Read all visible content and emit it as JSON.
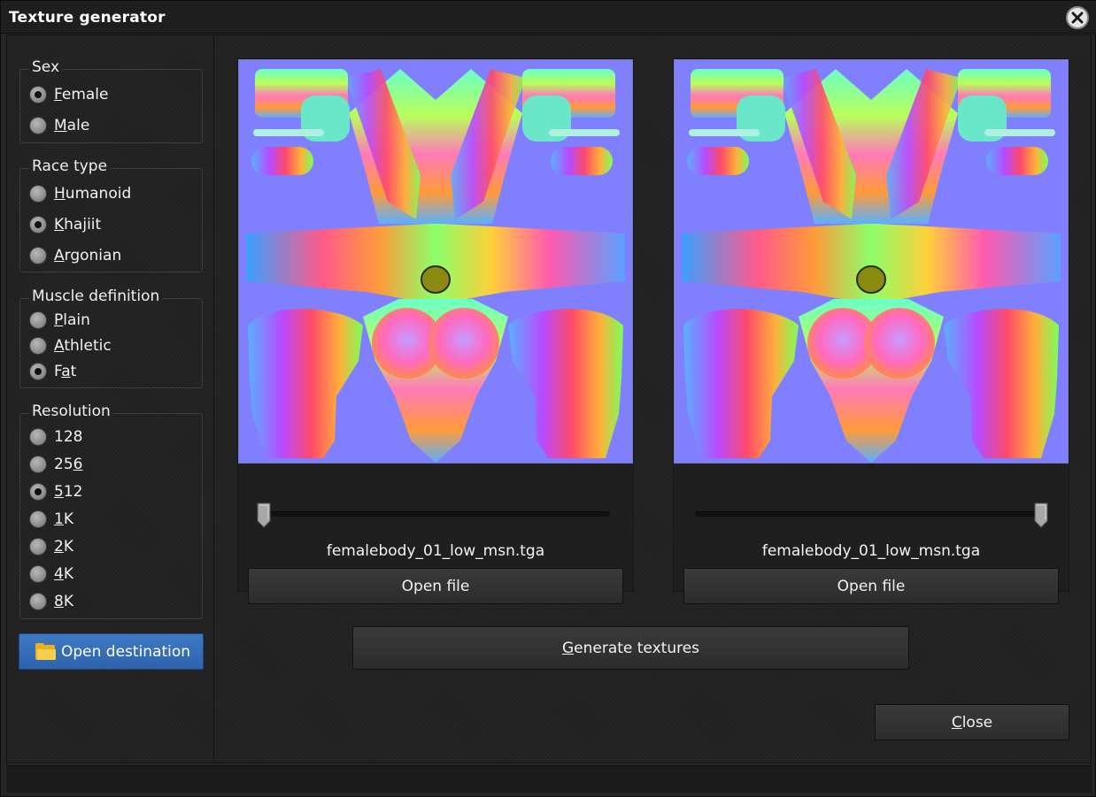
{
  "window": {
    "title": "Texture generator"
  },
  "sidebar": {
    "sex": {
      "label": "Sex",
      "options": [
        {
          "pre": "",
          "ul": "F",
          "post": "emale",
          "checked": true
        },
        {
          "pre": "",
          "ul": "M",
          "post": "ale",
          "checked": false
        }
      ]
    },
    "race": {
      "label": "Race type",
      "options": [
        {
          "pre": "",
          "ul": "H",
          "post": "umanoid",
          "checked": false
        },
        {
          "pre": "",
          "ul": "K",
          "post": "hajiit",
          "checked": true
        },
        {
          "pre": "",
          "ul": "A",
          "post": "rgonian",
          "checked": false
        }
      ]
    },
    "muscle": {
      "label": "Muscle definition",
      "options": [
        {
          "pre": "",
          "ul": "P",
          "post": "lain",
          "checked": false
        },
        {
          "pre": "",
          "ul": "A",
          "post": "thletic",
          "checked": false
        },
        {
          "pre": "F",
          "ul": "a",
          "post": "t",
          "checked": true
        }
      ]
    },
    "resolution": {
      "label": "Resolution",
      "options": [
        {
          "pre": "128",
          "ul": "",
          "post": "",
          "checked": false
        },
        {
          "pre": "25",
          "ul": "6",
          "post": "",
          "checked": false
        },
        {
          "pre": "",
          "ul": "5",
          "post": "12",
          "checked": true
        },
        {
          "pre": "",
          "ul": "1",
          "post": "K",
          "checked": false
        },
        {
          "pre": "",
          "ul": "2",
          "post": "K",
          "checked": false
        },
        {
          "pre": "",
          "ul": "4",
          "post": "K",
          "checked": false
        },
        {
          "pre": "",
          "ul": "8",
          "post": "K",
          "checked": false
        }
      ]
    },
    "open_destination": "Open destination"
  },
  "panels": [
    {
      "filename": "femalebody_01_low_msn.tga",
      "open_label": "Open file",
      "slider_value": 0
    },
    {
      "filename": "femalebody_01_low_msn.tga",
      "open_label": "Open file",
      "slider_value": 1
    }
  ],
  "generate": {
    "ul": "G",
    "post": "enerate textures"
  },
  "close": {
    "ul": "C",
    "post": "lose"
  },
  "colors": {
    "accent_blue": "#3a72be",
    "texture_bg": "#8080ff"
  }
}
